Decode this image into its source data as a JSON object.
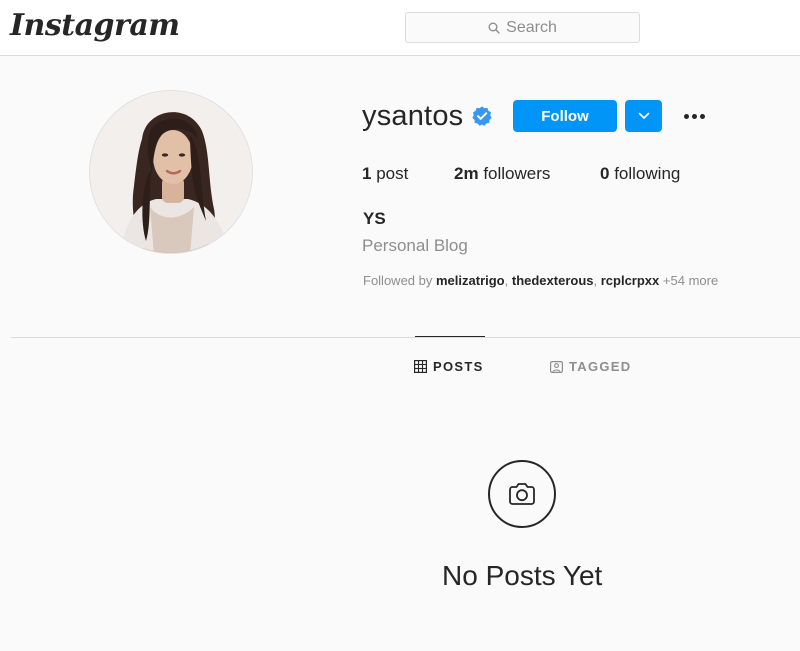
{
  "header": {
    "logo": "Instagram",
    "search_placeholder": "Search"
  },
  "profile": {
    "username": "ysantos",
    "verified": true,
    "follow_label": "Follow",
    "stats": {
      "posts_count": "1",
      "posts_label": "post",
      "followers_count": "2m",
      "followers_label": "followers",
      "following_count": "0",
      "following_label": "following"
    },
    "full_name": "YS",
    "category": "Personal Blog",
    "followed_by_prefix": "Followed by",
    "followed_by_users": [
      "melizatrigo",
      "thedexterous",
      "rcplcrpxx"
    ],
    "followed_by_more": "+54 more"
  },
  "tabs": [
    {
      "label": "POSTS",
      "icon": "grid-icon",
      "active": true
    },
    {
      "label": "TAGGED",
      "icon": "tagged-icon",
      "active": false
    }
  ],
  "empty_state": {
    "icon": "camera-icon",
    "text": "No Posts Yet"
  },
  "colors": {
    "accent": "#0095f6",
    "verified": "#3897f0",
    "muted_text": "#8e8e8e",
    "border": "#dbdbdb"
  }
}
